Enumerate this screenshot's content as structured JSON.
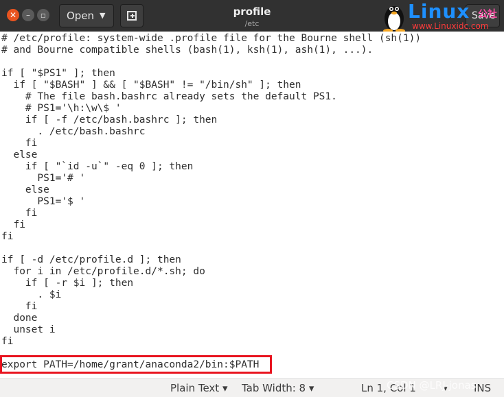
{
  "window": {
    "title": "profile",
    "subtitle": "/etc"
  },
  "header": {
    "open_label": "Open",
    "save_label": "Save"
  },
  "watermark": {
    "logo_text": "Linux",
    "logo_cn": "公社",
    "logo_url": "www.Linuxidc.com",
    "csdn": "CSDN @LRJ-jonas"
  },
  "editor": {
    "lines": [
      "# /etc/profile: system-wide .profile file for the Bourne shell (sh(1))",
      "# and Bourne compatible shells (bash(1), ksh(1), ash(1), ...).",
      "",
      "if [ \"$PS1\" ]; then",
      "  if [ \"$BASH\" ] && [ \"$BASH\" != \"/bin/sh\" ]; then",
      "    # The file bash.bashrc already sets the default PS1.",
      "    # PS1='\\h:\\w\\$ '",
      "    if [ -f /etc/bash.bashrc ]; then",
      "      . /etc/bash.bashrc",
      "    fi",
      "  else",
      "    if [ \"`id -u`\" -eq 0 ]; then",
      "      PS1='# '",
      "    else",
      "      PS1='$ '",
      "    fi",
      "  fi",
      "fi",
      "",
      "if [ -d /etc/profile.d ]; then",
      "  for i in /etc/profile.d/*.sh; do",
      "    if [ -r $i ]; then",
      "      . $i",
      "    fi",
      "  done",
      "  unset i",
      "fi",
      "",
      "export PATH=/home/grant/anaconda2/bin:$PATH"
    ]
  },
  "statusbar": {
    "language": "Plain Text ▾",
    "tab_width": "Tab Width: 8 ▾",
    "position": "Ln 1, Col 1",
    "dropdown": "▾",
    "mode": "INS"
  },
  "colors": {
    "header_bg": "#313131",
    "close_button": "#e95420",
    "highlight_border": "#e8141f"
  }
}
